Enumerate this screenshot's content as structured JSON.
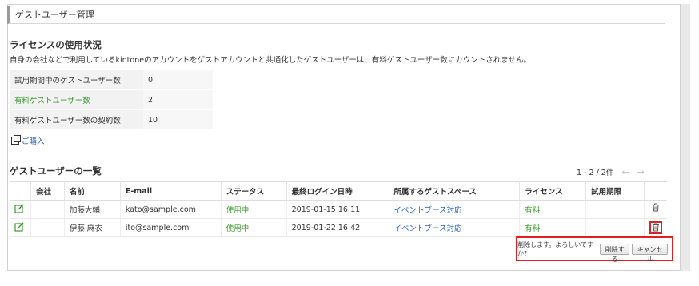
{
  "header": {
    "title": "ゲストユーザー管理"
  },
  "license": {
    "heading": "ライセンスの使用状況",
    "description": "自身の会社などで利用しているkintoneのアカウントをゲストアカウントと共通化したゲストユーザーは、有料ゲストユーザー数にカウントされません。",
    "rows": [
      {
        "label": "試用期間中のゲストユーザー数",
        "value": "0"
      },
      {
        "label": "有料ゲストユーザー数",
        "value": "2"
      },
      {
        "label": "有料ゲストユーザー数の契約数",
        "value": "10"
      }
    ],
    "purchase_link": "ご購入"
  },
  "guest_list": {
    "heading": "ゲストユーザーの一覧",
    "pager_text": "1 - 2 / 2件",
    "columns": [
      "",
      "会社",
      "名前",
      "E-mail",
      "ステータス",
      "最終ログイン日時",
      "所属するゲストスペース",
      "ライセンス",
      "試用期限",
      ""
    ],
    "rows": [
      {
        "company": "",
        "name": "加藤大輔",
        "email": "kato@sample.com",
        "status": "使用中",
        "last_login": "2019-01-15 16:11",
        "space": "イベントブース対応",
        "license": "有料",
        "trial": ""
      },
      {
        "company": "",
        "name": "伊藤 麻衣",
        "email": "ito@sample.com",
        "status": "使用中",
        "last_login": "2019-01-22 16:42",
        "space": "イベントブース対応",
        "license": "有料",
        "trial": ""
      }
    ]
  },
  "confirm": {
    "message": "削除します。よろしいですか?",
    "delete_label": "削除する",
    "cancel_label": "キャンセル"
  },
  "colors": {
    "link": "#2a66c4",
    "green": "#3b9a2f",
    "highlight": "#e02020"
  }
}
